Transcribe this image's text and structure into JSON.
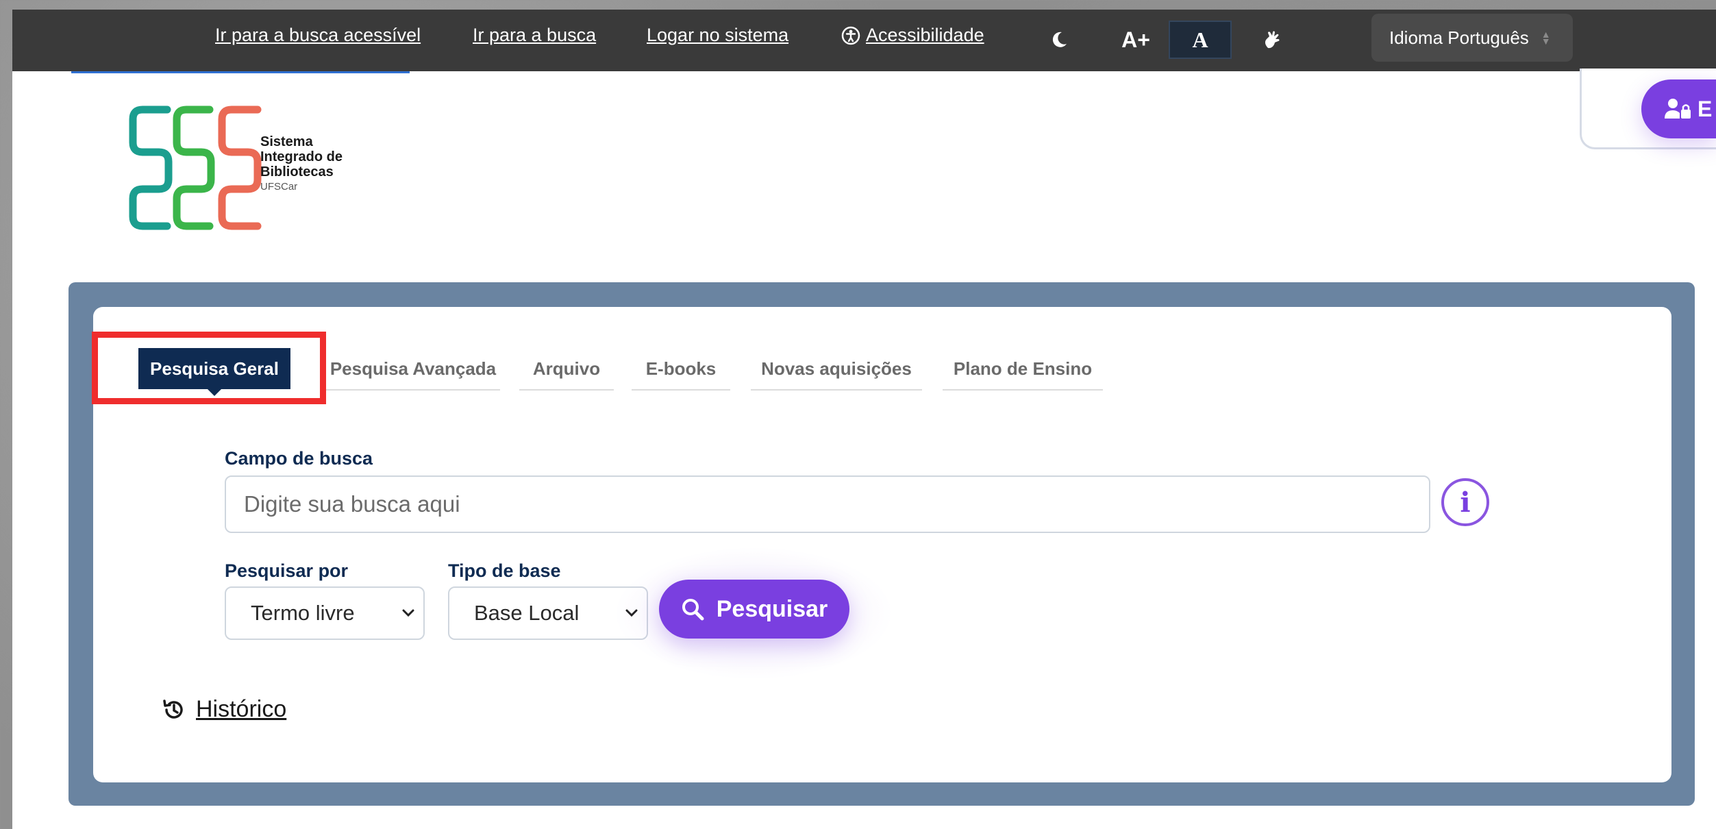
{
  "topbar": {
    "links": [
      "Ir para a busca acessível",
      "Ir para a busca",
      "Logar no sistema"
    ],
    "accessibility_label": "Acessibilidade",
    "font_increase_label": "A+",
    "font_normal_label": "A",
    "language_label": "Idioma Português",
    "icons": [
      "accessibility-icon",
      "moon-icon",
      "sign-language-hand-icon",
      "sort-arrows-icon"
    ]
  },
  "logo": {
    "line1": "Sistema",
    "line2": "Integrado de",
    "line3": "Bibliotecas",
    "line4": "UFSCar"
  },
  "corner_button": {
    "label": "E",
    "icon": "user-lock-icon"
  },
  "tabs": [
    {
      "label": "Pesquisa Geral",
      "active": true
    },
    {
      "label": "Pesquisa Avançada",
      "active": false
    },
    {
      "label": "Arquivo",
      "active": false
    },
    {
      "label": "E-books",
      "active": false
    },
    {
      "label": "Novas aquisições",
      "active": false
    },
    {
      "label": "Plano de Ensino",
      "active": false
    }
  ],
  "search": {
    "field_label": "Campo de busca",
    "placeholder": "Digite sua busca aqui",
    "value": "",
    "info_label": "i",
    "search_by_label": "Pesquisar por",
    "search_by_value": "Termo livre",
    "base_type_label": "Tipo de base",
    "base_type_value": "Base Local",
    "submit_label": "Pesquisar"
  },
  "history_label": "Histórico",
  "colors": {
    "topbar_bg": "#3a3a3a",
    "accent_purple": "#7a3fe0",
    "navy": "#0f2b52",
    "panel_bg": "#6a84a1",
    "highlight_red": "#ef2d2d",
    "logo_teal": "#1b9e8f",
    "logo_green": "#3bb54a",
    "logo_coral": "#ea6a55"
  }
}
